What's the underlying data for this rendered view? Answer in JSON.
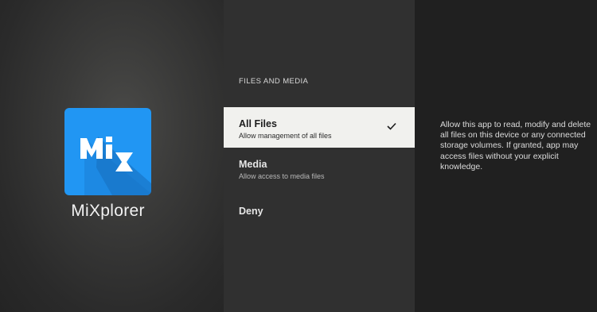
{
  "app": {
    "name": "MiXplorer",
    "icon": "mixplorer-logo-icon",
    "icon_color": "#2196f3"
  },
  "permissions": {
    "section_title": "FILES AND MEDIA",
    "selected_index": 0,
    "options": [
      {
        "label": "All Files",
        "sublabel": "Allow management of all files",
        "selected": true
      },
      {
        "label": "Media",
        "sublabel": "Allow access to media files",
        "selected": false
      },
      {
        "label": "Deny",
        "sublabel": "",
        "selected": false
      }
    ]
  },
  "description": "Allow this app to read, modify and delete all files on this device or any connected storage volumes. If granted, app may access files without your explicit knowledge.",
  "colors": {
    "selected_background": "#f1f1ee",
    "middle_background": "#303030",
    "right_background": "#202020"
  }
}
